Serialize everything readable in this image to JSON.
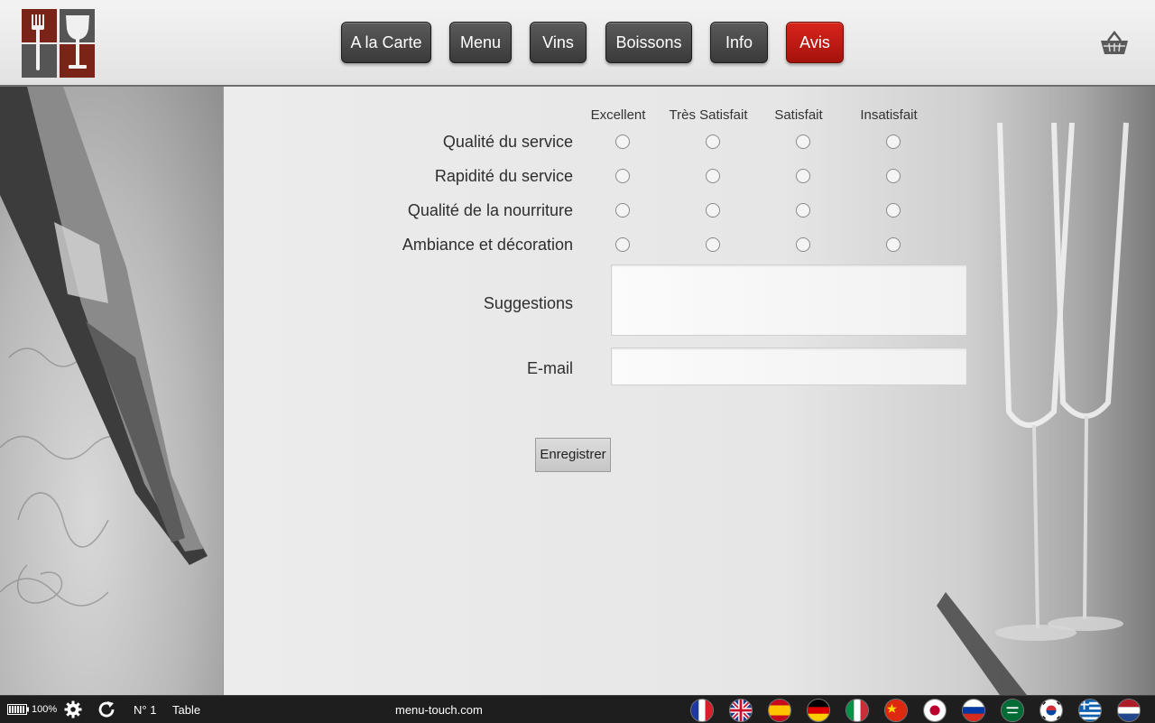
{
  "nav": {
    "items": [
      {
        "label": "A la Carte"
      },
      {
        "label": "Menu"
      },
      {
        "label": "Vins"
      },
      {
        "label": "Boissons"
      },
      {
        "label": "Info"
      },
      {
        "label": "Avis",
        "active": true
      }
    ]
  },
  "icons": {
    "logo": "restaurant-fork-glass-logo",
    "basket": "basket-icon"
  },
  "survey": {
    "columns": [
      "Excellent",
      "Très Satisfait",
      "Satisfait",
      "Insatisfait"
    ],
    "rows": [
      "Qualité du service",
      "Rapidité du service",
      "Qualité de la nourriture",
      "Ambiance et décoration"
    ],
    "suggestions_label": "Suggestions",
    "suggestions_value": "",
    "email_label": "E-mail",
    "email_value": "",
    "save_label": "Enregistrer"
  },
  "footer": {
    "battery": "100%",
    "table_number": "N° 1",
    "table_label": "Table",
    "site": "menu-touch.com",
    "flags": [
      "France",
      "United Kingdom",
      "Spain",
      "Germany",
      "Italy",
      "China",
      "Japan",
      "Russia",
      "Saudi Arabia",
      "South Korea",
      "Greece",
      "Netherlands"
    ]
  },
  "colors": {
    "accent": "#c41a14",
    "nav_button": "#444444",
    "footer_bg": "#1e1e1e"
  }
}
